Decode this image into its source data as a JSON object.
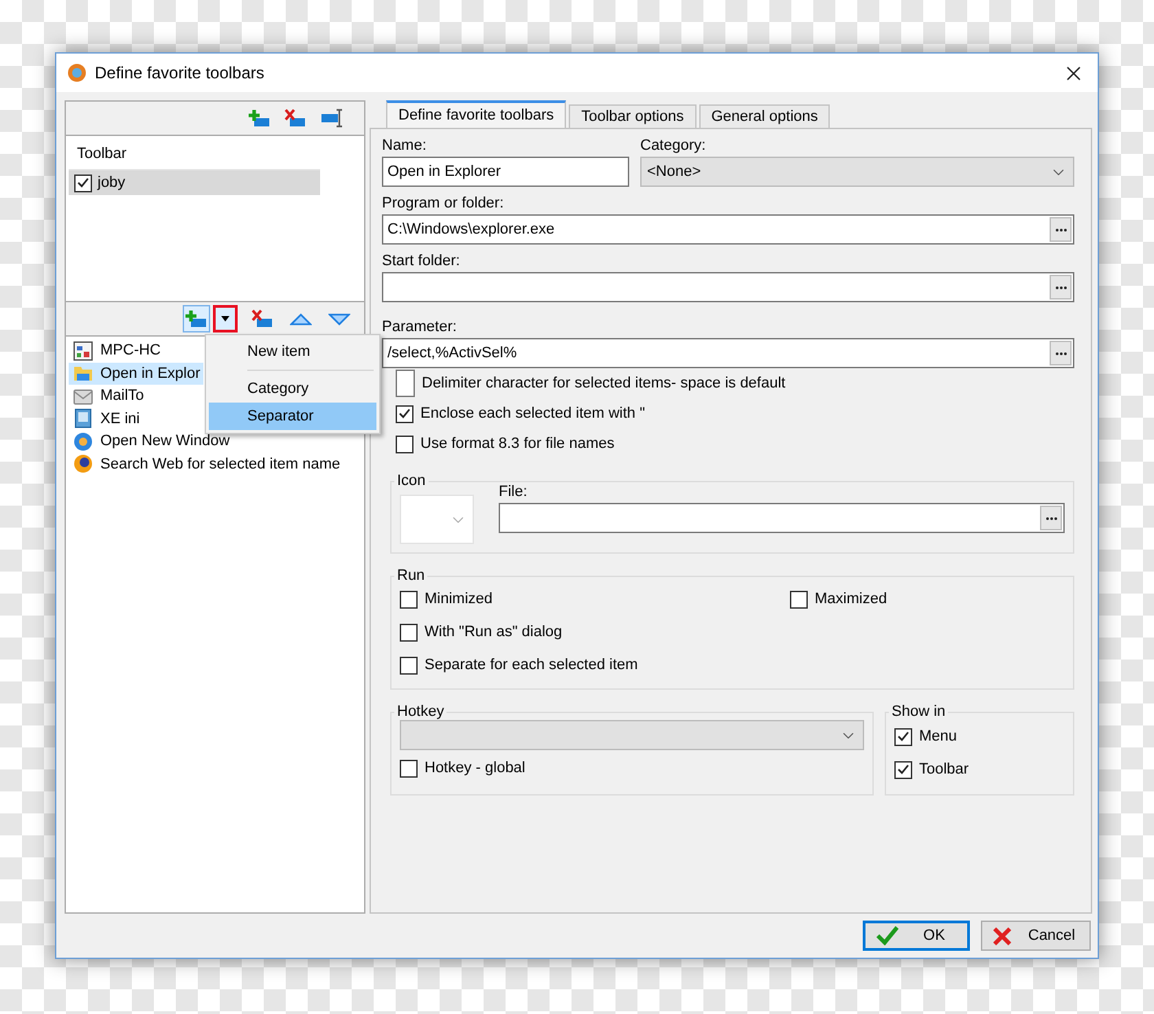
{
  "window": {
    "title": "Define favorite toolbars"
  },
  "toolbars": {
    "column": "Toolbar",
    "items": [
      {
        "label": "joby",
        "checked": true,
        "selected": true
      }
    ]
  },
  "items": [
    {
      "label": "MPC-HC",
      "kind": "player",
      "selected": false
    },
    {
      "label": "Open in Explor",
      "kind": "folder",
      "selected": true
    },
    {
      "label": "MailTo",
      "kind": "mail",
      "selected": false
    },
    {
      "label": "XE ini",
      "kind": "file",
      "selected": false
    },
    {
      "label": "Open New Window",
      "kind": "globe",
      "selected": false
    },
    {
      "label": "Search Web for selected item name",
      "kind": "browser",
      "selected": false
    }
  ],
  "add_menu": {
    "expanded": true,
    "items": [
      {
        "kind": "entry",
        "label": "New item",
        "selected": false
      },
      {
        "kind": "divider"
      },
      {
        "kind": "entry",
        "label": "Category",
        "selected": false
      },
      {
        "kind": "entry",
        "label": "Separator",
        "selected": true
      }
    ]
  },
  "tabs": [
    {
      "label": "Define favorite toolbars",
      "selected": true
    },
    {
      "label": "Toolbar options",
      "selected": false
    },
    {
      "label": "General options",
      "selected": false
    }
  ],
  "name": {
    "label": "Name:",
    "value": "Open in Explorer"
  },
  "category": {
    "label": "Category:",
    "value": "<None>"
  },
  "program": {
    "label": "Program or folder:",
    "value": "C:\\Windows\\explorer.exe"
  },
  "start_folder": {
    "label": "Start folder:"
  },
  "parameter": {
    "label": "Parameter:",
    "value": "/select,%ActivSel%"
  },
  "parameter_options": [
    {
      "kind": "textbox",
      "label": "Delimiter character for selected items- space is default"
    },
    {
      "kind": "checkbox",
      "label": "Enclose each selected item with \"",
      "checked": true
    },
    {
      "kind": "checkbox",
      "label": "Use format 8.3 for file names",
      "checked": false
    }
  ],
  "icon_group": {
    "title": "Icon",
    "file_label": "File:"
  },
  "run": {
    "title": "Run",
    "options": [
      {
        "label": "Minimized",
        "checked": false
      },
      {
        "label": "Maximized",
        "checked": false
      },
      {
        "label": "With \"Run as\" dialog",
        "checked": false
      },
      {
        "label": "Separate for each selected item",
        "checked": false
      }
    ]
  },
  "hotkey": {
    "title": "Hotkey",
    "disabled": true,
    "global": {
      "label": "Hotkey - global",
      "checked": false
    }
  },
  "show_in": {
    "title": "Show in",
    "options": [
      {
        "label": "Menu",
        "checked": true
      },
      {
        "label": "Toolbar",
        "checked": true
      }
    ]
  },
  "buttons": [
    {
      "label": "OK",
      "kind": "ok",
      "default": true
    },
    {
      "label": "Cancel",
      "kind": "cancel",
      "default": false
    }
  ]
}
